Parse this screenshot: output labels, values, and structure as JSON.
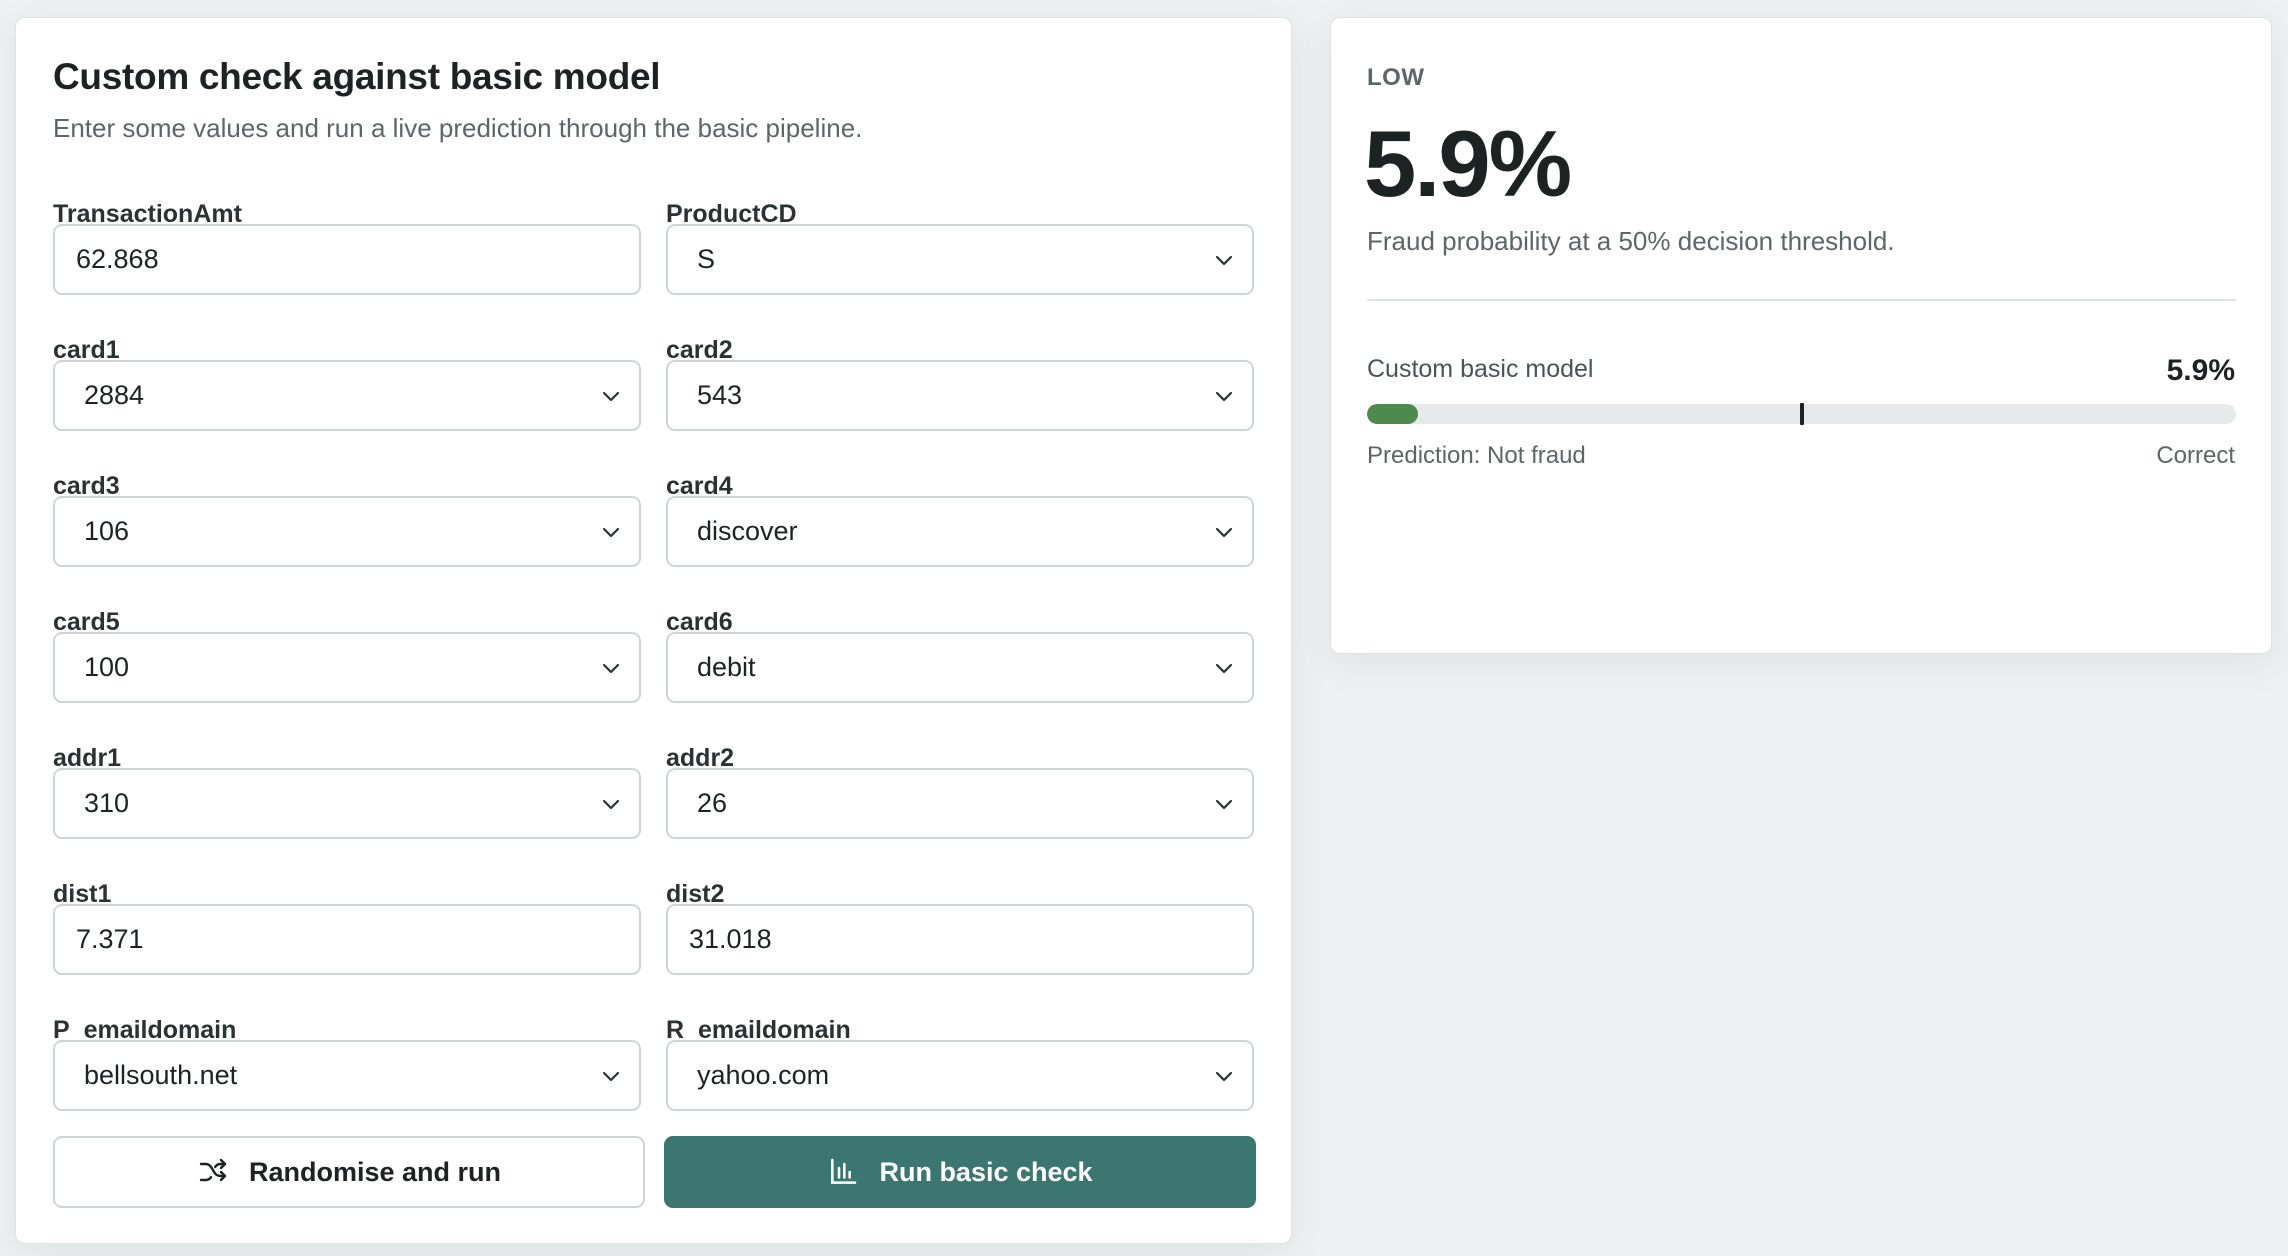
{
  "form": {
    "title": "Custom check against basic model",
    "subtitle": "Enter some values and run a live prediction through the basic pipeline.",
    "fields": {
      "TransactionAmt": {
        "label": "TransactionAmt",
        "value": "62.868"
      },
      "ProductCD": {
        "label": "ProductCD",
        "value": "S"
      },
      "card1": {
        "label": "card1",
        "value": "2884"
      },
      "card2": {
        "label": "card2",
        "value": "543"
      },
      "card3": {
        "label": "card3",
        "value": "106"
      },
      "card4": {
        "label": "card4",
        "value": "discover"
      },
      "card5": {
        "label": "card5",
        "value": "100"
      },
      "card6": {
        "label": "card6",
        "value": "debit"
      },
      "addr1": {
        "label": "addr1",
        "value": "310"
      },
      "addr2": {
        "label": "addr2",
        "value": "26"
      },
      "dist1": {
        "label": "dist1",
        "value": "7.371"
      },
      "dist2": {
        "label": "dist2",
        "value": "31.018"
      },
      "P_emaildomain": {
        "label": "P_emaildomain",
        "value": "bellsouth.net"
      },
      "R_emaildomain": {
        "label": "R_emaildomain",
        "value": "yahoo.com"
      }
    },
    "buttons": {
      "randomise_label": "Randomise and run",
      "run_label": "Run basic check"
    },
    "icons": {
      "randomise": "shuffle-icon",
      "run": "bar-chart-icon",
      "select": "chevron-down-icon"
    }
  },
  "result": {
    "risk_level": "LOW",
    "probability": "5.9%",
    "description": "Fraud probability at a 50% decision threshold.",
    "model_name": "Custom basic model",
    "model_probability": "5.9%",
    "bar_fraction": 0.059,
    "threshold_fraction": 0.5,
    "prediction": "Prediction: Not fraud",
    "verdict": "Correct"
  },
  "colors": {
    "accent": "#3b7770",
    "bar_fill": "#4c8a4d",
    "track": "#e6eaea"
  }
}
